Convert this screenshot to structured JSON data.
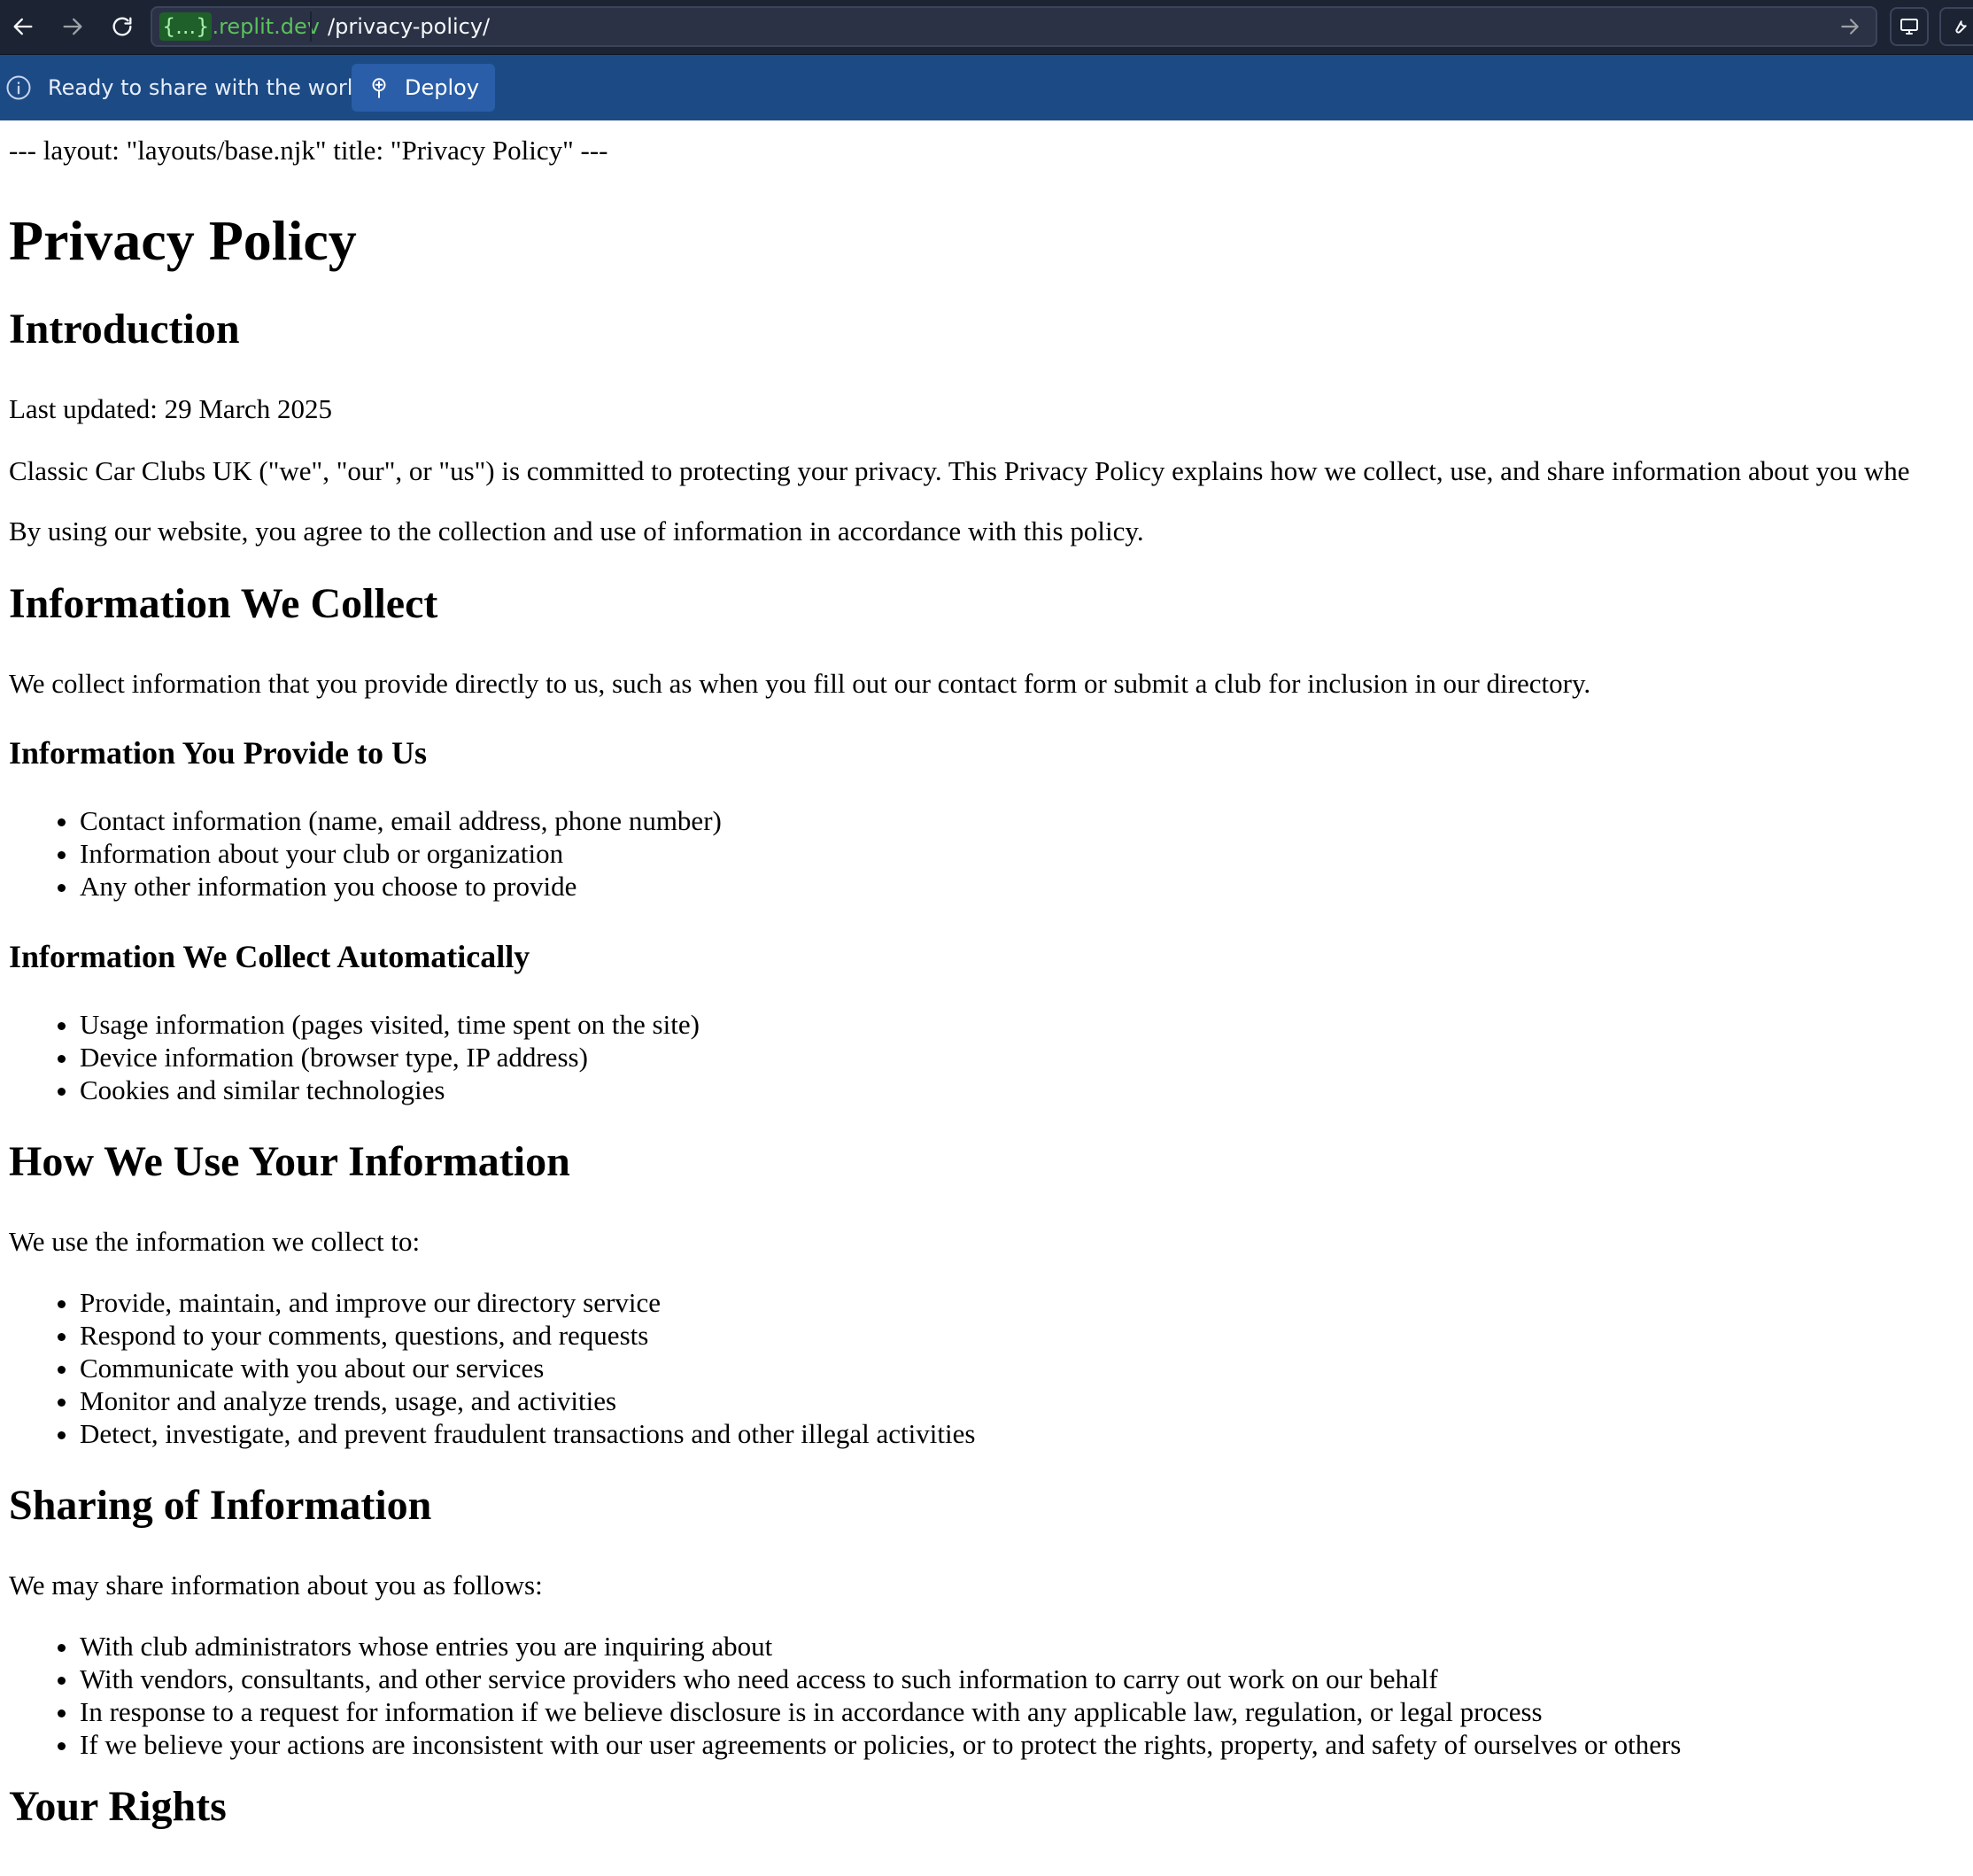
{
  "browser": {
    "domain_braces": "{...}",
    "domain_suffix": ".replit.dev",
    "path": "/privacy-policy/"
  },
  "banner": {
    "text": "Ready to share with the world?",
    "deploy_label": "Deploy"
  },
  "page": {
    "front_matter": "--- layout: \"layouts/base.njk\" title: \"Privacy Policy\" ---",
    "title": "Privacy Policy",
    "intro": {
      "heading": "Introduction",
      "updated": "Last updated: 29 March 2025",
      "p1": "Classic Car Clubs UK (\"we\", \"our\", or \"us\") is committed to protecting your privacy. This Privacy Policy explains how we collect, use, and share information about you whe",
      "p2": "By using our website, you agree to the collection and use of information in accordance with this policy."
    },
    "collect": {
      "heading": "Information We Collect",
      "p": "We collect information that you provide directly to us, such as when you fill out our contact form or submit a club for inclusion in our directory.",
      "provide_heading": "Information You Provide to Us",
      "provide_items": [
        "Contact information (name, email address, phone number)",
        "Information about your club or organization",
        "Any other information you choose to provide"
      ],
      "auto_heading": "Information We Collect Automatically",
      "auto_items": [
        "Usage information (pages visited, time spent on the site)",
        "Device information (browser type, IP address)",
        "Cookies and similar technologies"
      ]
    },
    "use": {
      "heading": "How We Use Your Information",
      "p": "We use the information we collect to:",
      "items": [
        "Provide, maintain, and improve our directory service",
        "Respond to your comments, questions, and requests",
        "Communicate with you about our services",
        "Monitor and analyze trends, usage, and activities",
        "Detect, investigate, and prevent fraudulent transactions and other illegal activities"
      ]
    },
    "sharing": {
      "heading": "Sharing of Information",
      "p": "We may share information about you as follows:",
      "items": [
        "With club administrators whose entries you are inquiring about",
        "With vendors, consultants, and other service providers who need access to such information to carry out work on our behalf",
        "In response to a request for information if we believe disclosure is in accordance with any applicable law, regulation, or legal process",
        "If we believe your actions are inconsistent with our user agreements or policies, or to protect the rights, property, and safety of ourselves or others"
      ]
    },
    "rights": {
      "heading": "Your Rights"
    }
  }
}
